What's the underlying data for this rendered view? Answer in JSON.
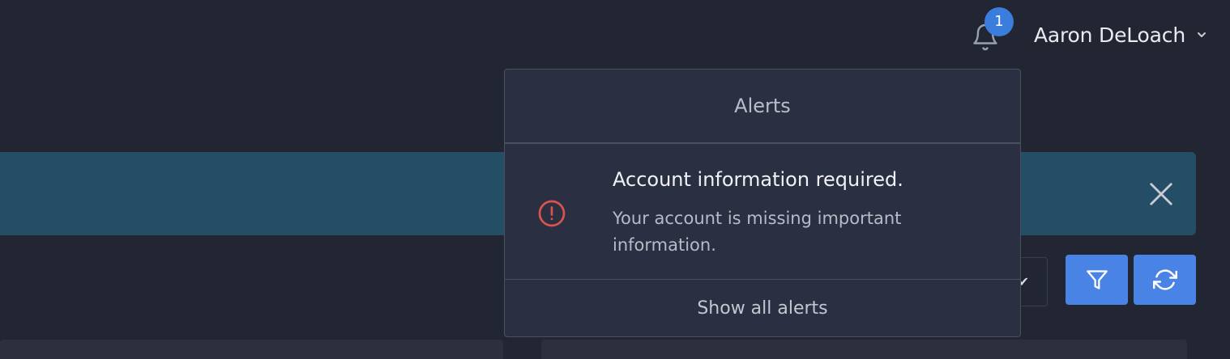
{
  "header": {
    "notification_count": "1",
    "user_name": "Aaron DeLoach",
    "icons": {
      "bell": "bell-icon",
      "user_menu": "chevron-down-icon"
    }
  },
  "banner": {
    "close_icon": "close-icon"
  },
  "toolbar": {
    "filter_icon": "filter-icon",
    "refresh_icon": "refresh-icon",
    "select_icon": "check-icon"
  },
  "alerts": {
    "title": "Alerts",
    "items": [
      {
        "icon": "exclamation-circle-icon",
        "title": "Account information required.",
        "description": "Your account is missing important information."
      }
    ],
    "footer_label": "Show all alerts"
  },
  "colors": {
    "background": "#222633",
    "banner": "#244d66",
    "accent": "#4a83e6",
    "badge": "#3b7ddd",
    "alert_icon": "#d9534f",
    "dropdown": "#2b2f42"
  }
}
